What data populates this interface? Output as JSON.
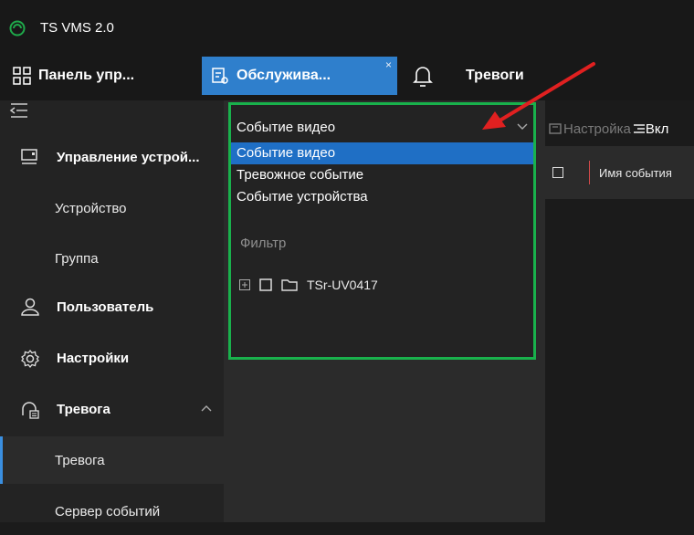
{
  "app": {
    "title": "TS VMS 2.0"
  },
  "tabs": [
    {
      "label": "Панель упр...",
      "icon": "grid-icon"
    },
    {
      "label": "Обслужива...",
      "icon": "list-doc-icon",
      "close": "×"
    },
    {
      "label": "Тревоги",
      "icon": "bell-icon"
    }
  ],
  "sidebar": {
    "items": [
      {
        "label": "Управление устрой...",
        "icon": "device-icon"
      },
      {
        "label": "Устройство"
      },
      {
        "label": "Группа"
      },
      {
        "label": "Пользователь",
        "icon": "user-icon"
      },
      {
        "label": "Настройки",
        "icon": "gear-icon"
      },
      {
        "label": "Тревога",
        "icon": "alarm-icon"
      },
      {
        "label": "Тревога"
      },
      {
        "label": "Сервер событий"
      }
    ]
  },
  "dropdown": {
    "selected": "Событие видео",
    "options": [
      "Событие видео",
      "Тревожное событие",
      "Событие устройства"
    ]
  },
  "filter": {
    "label": "Фильтр",
    "tree": [
      {
        "label": "TSr-UV0417",
        "expand": "+"
      }
    ]
  },
  "right": {
    "toolbar_settings": "Настройка",
    "toolbar_include": "Вкл",
    "column_event_name": "Имя события"
  },
  "colors": {
    "accent": "#2f7fcc",
    "selection": "#1f6fc5",
    "highlight_box": "#19b14c",
    "arrow": "#e02020"
  }
}
